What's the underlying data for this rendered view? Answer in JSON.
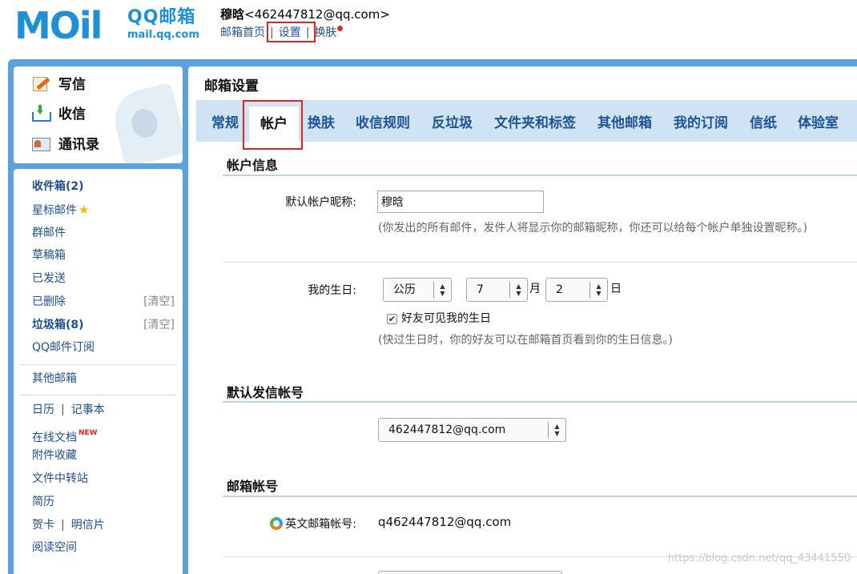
{
  "header": {
    "logo_mark": "MOil",
    "logo_brand": "QQ邮箱",
    "logo_url": "mail.qq.com",
    "user_name": "穆晗",
    "user_email": "<462447812@qq.com>",
    "links": [
      "邮箱首页",
      "设置",
      "换肤"
    ],
    "separator": "|"
  },
  "left_top": {
    "items": [
      "写信",
      "收信",
      "通讯录"
    ]
  },
  "folders": [
    {
      "label": "收件箱(2)",
      "bold": true
    },
    {
      "label": "星标邮件",
      "star": "★"
    },
    {
      "label": "群邮件"
    },
    {
      "label": "草稿箱"
    },
    {
      "label": "已发送"
    },
    {
      "label": "已删除",
      "action": "[清空]"
    },
    {
      "label": "垃圾箱(8)",
      "bold": true,
      "action": "[清空]"
    },
    {
      "label": "QQ邮件订阅"
    },
    {
      "label": "其他邮箱"
    },
    {
      "label": "日历",
      "pair": "记事本"
    },
    {
      "label": "在线文档",
      "badge": "NEW"
    },
    {
      "label": "附件收藏"
    },
    {
      "label": "文件中转站"
    },
    {
      "label": "简历"
    },
    {
      "label": "贺卡",
      "pair": "明信片"
    },
    {
      "label": "阅读空间"
    }
  ],
  "content": {
    "title": "邮箱设置",
    "tabs": [
      "常规",
      "帐户",
      "换肤",
      "收信规则",
      "反垃圾",
      "文件夹和标签",
      "其他邮箱",
      "我的订阅",
      "信纸",
      "体验室"
    ],
    "active_tab": "帐户",
    "account_info": {
      "section_title": "帐户信息",
      "nickname_label": "默认帐户昵称:",
      "nickname_value": "穆晗",
      "nickname_hint": "(你发出的所有邮件，发件人将显示你的邮箱昵称，你还可以给每个帐户单独设置昵称。)",
      "birthday_label": "我的生日:",
      "calendar_value": "公历",
      "month_value": "7",
      "month_unit": "月",
      "day_value": "2",
      "day_unit": "日",
      "friends_checkbox_label": "好友可见我的生日",
      "friends_checkbox_checked": true,
      "birthday_hint": "(快过生日时，你的好友可以在邮箱首页看到你的生日信息。)"
    },
    "default_sender": {
      "section_title": "默认发信帐号",
      "value": "462447812@qq.com"
    },
    "mailbox_account": {
      "section_title": "邮箱帐号",
      "english_label": "英文邮箱帐号:",
      "english_value": "q462447812@qq.com"
    }
  },
  "watermark": "https://blog.csdn.net/qq_43441550"
}
